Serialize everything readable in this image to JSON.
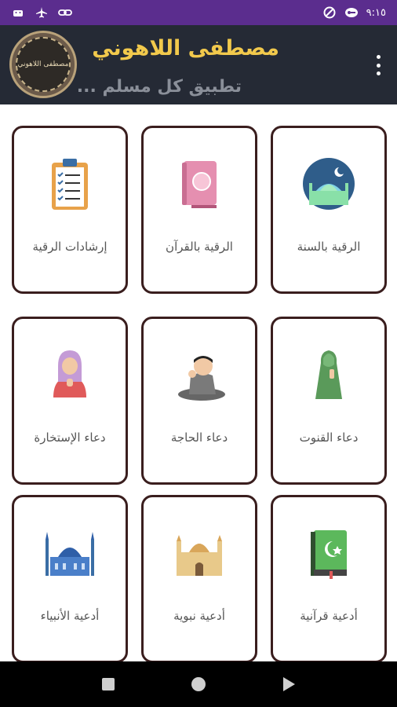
{
  "status_bar": {
    "time": "٩:١٥",
    "left_icons": [
      "android-icon",
      "airplane-icon",
      "link-icon"
    ],
    "right_icons": [
      "data-saver-icon",
      "vpn-icon"
    ]
  },
  "header": {
    "title": "مصطفى اللاهوني",
    "subtitle": "تطبيق كل مسلم ...",
    "logo_text": "مصطفى اللاهوني"
  },
  "cards": [
    {
      "label": "الرقية بالسنة",
      "icon": "mosque-icon"
    },
    {
      "label": "الرقية بالقرآن",
      "icon": "quran-icon"
    },
    {
      "label": "إرشادات الرقية",
      "icon": "clipboard-icon"
    },
    {
      "label": "دعاء القنوت",
      "icon": "woman-praying-icon"
    },
    {
      "label": "دعاء الحاجة",
      "icon": "boy-praying-icon"
    },
    {
      "label": "دعاء الإستخارة",
      "icon": "girl-praying-icon"
    },
    {
      "label": "أدعية قرآنية",
      "icon": "islamic-book-icon"
    },
    {
      "label": "أدعية نبوية",
      "icon": "golden-mosque-icon"
    },
    {
      "label": "أدعية الأنبياء",
      "icon": "blue-mosque-icon"
    }
  ],
  "colors": {
    "status_bar": "#5b2d8e",
    "header_bg": "#252a35",
    "title": "#f2c94c",
    "card_border": "#3a1e1e"
  }
}
